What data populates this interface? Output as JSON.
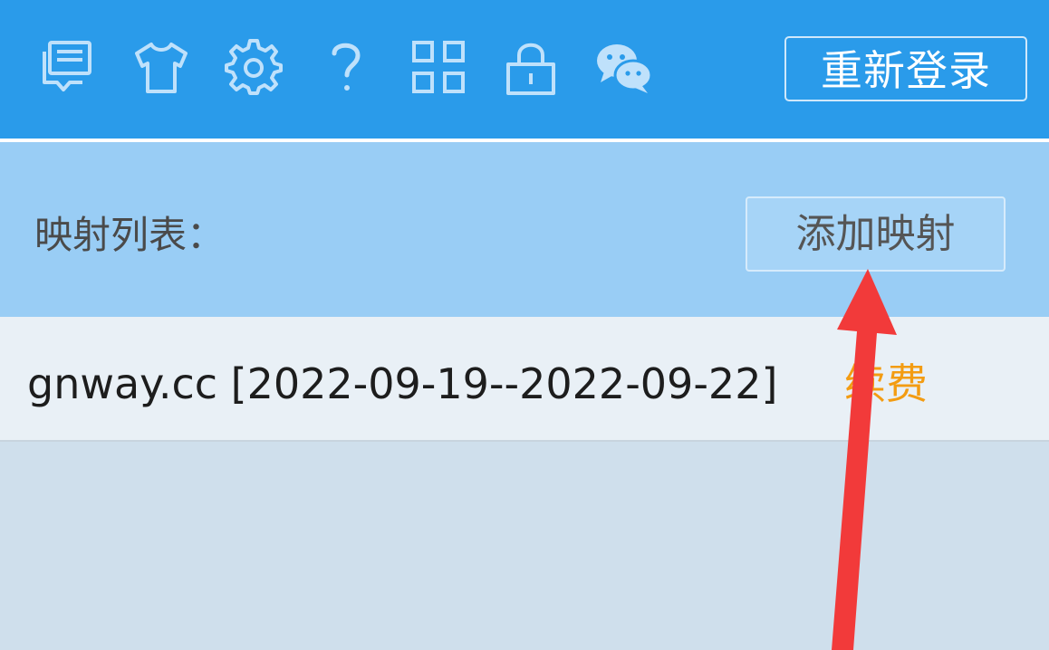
{
  "toolbar": {
    "icons": [
      "message-icon",
      "tshirt-icon",
      "gear-icon",
      "help-icon",
      "apps-grid-icon",
      "lock-icon",
      "wechat-icon"
    ],
    "relogin_label": "重新登录",
    "bg_color": "#2a9bea"
  },
  "mapping": {
    "title": "映射列表：",
    "add_button_label": "添加映射",
    "items": [
      {
        "text": "gnway.cc [2022-09-19--2022-09-22]",
        "action": "续费"
      }
    ]
  },
  "annotation": {
    "arrow_color": "#f23a3a"
  }
}
